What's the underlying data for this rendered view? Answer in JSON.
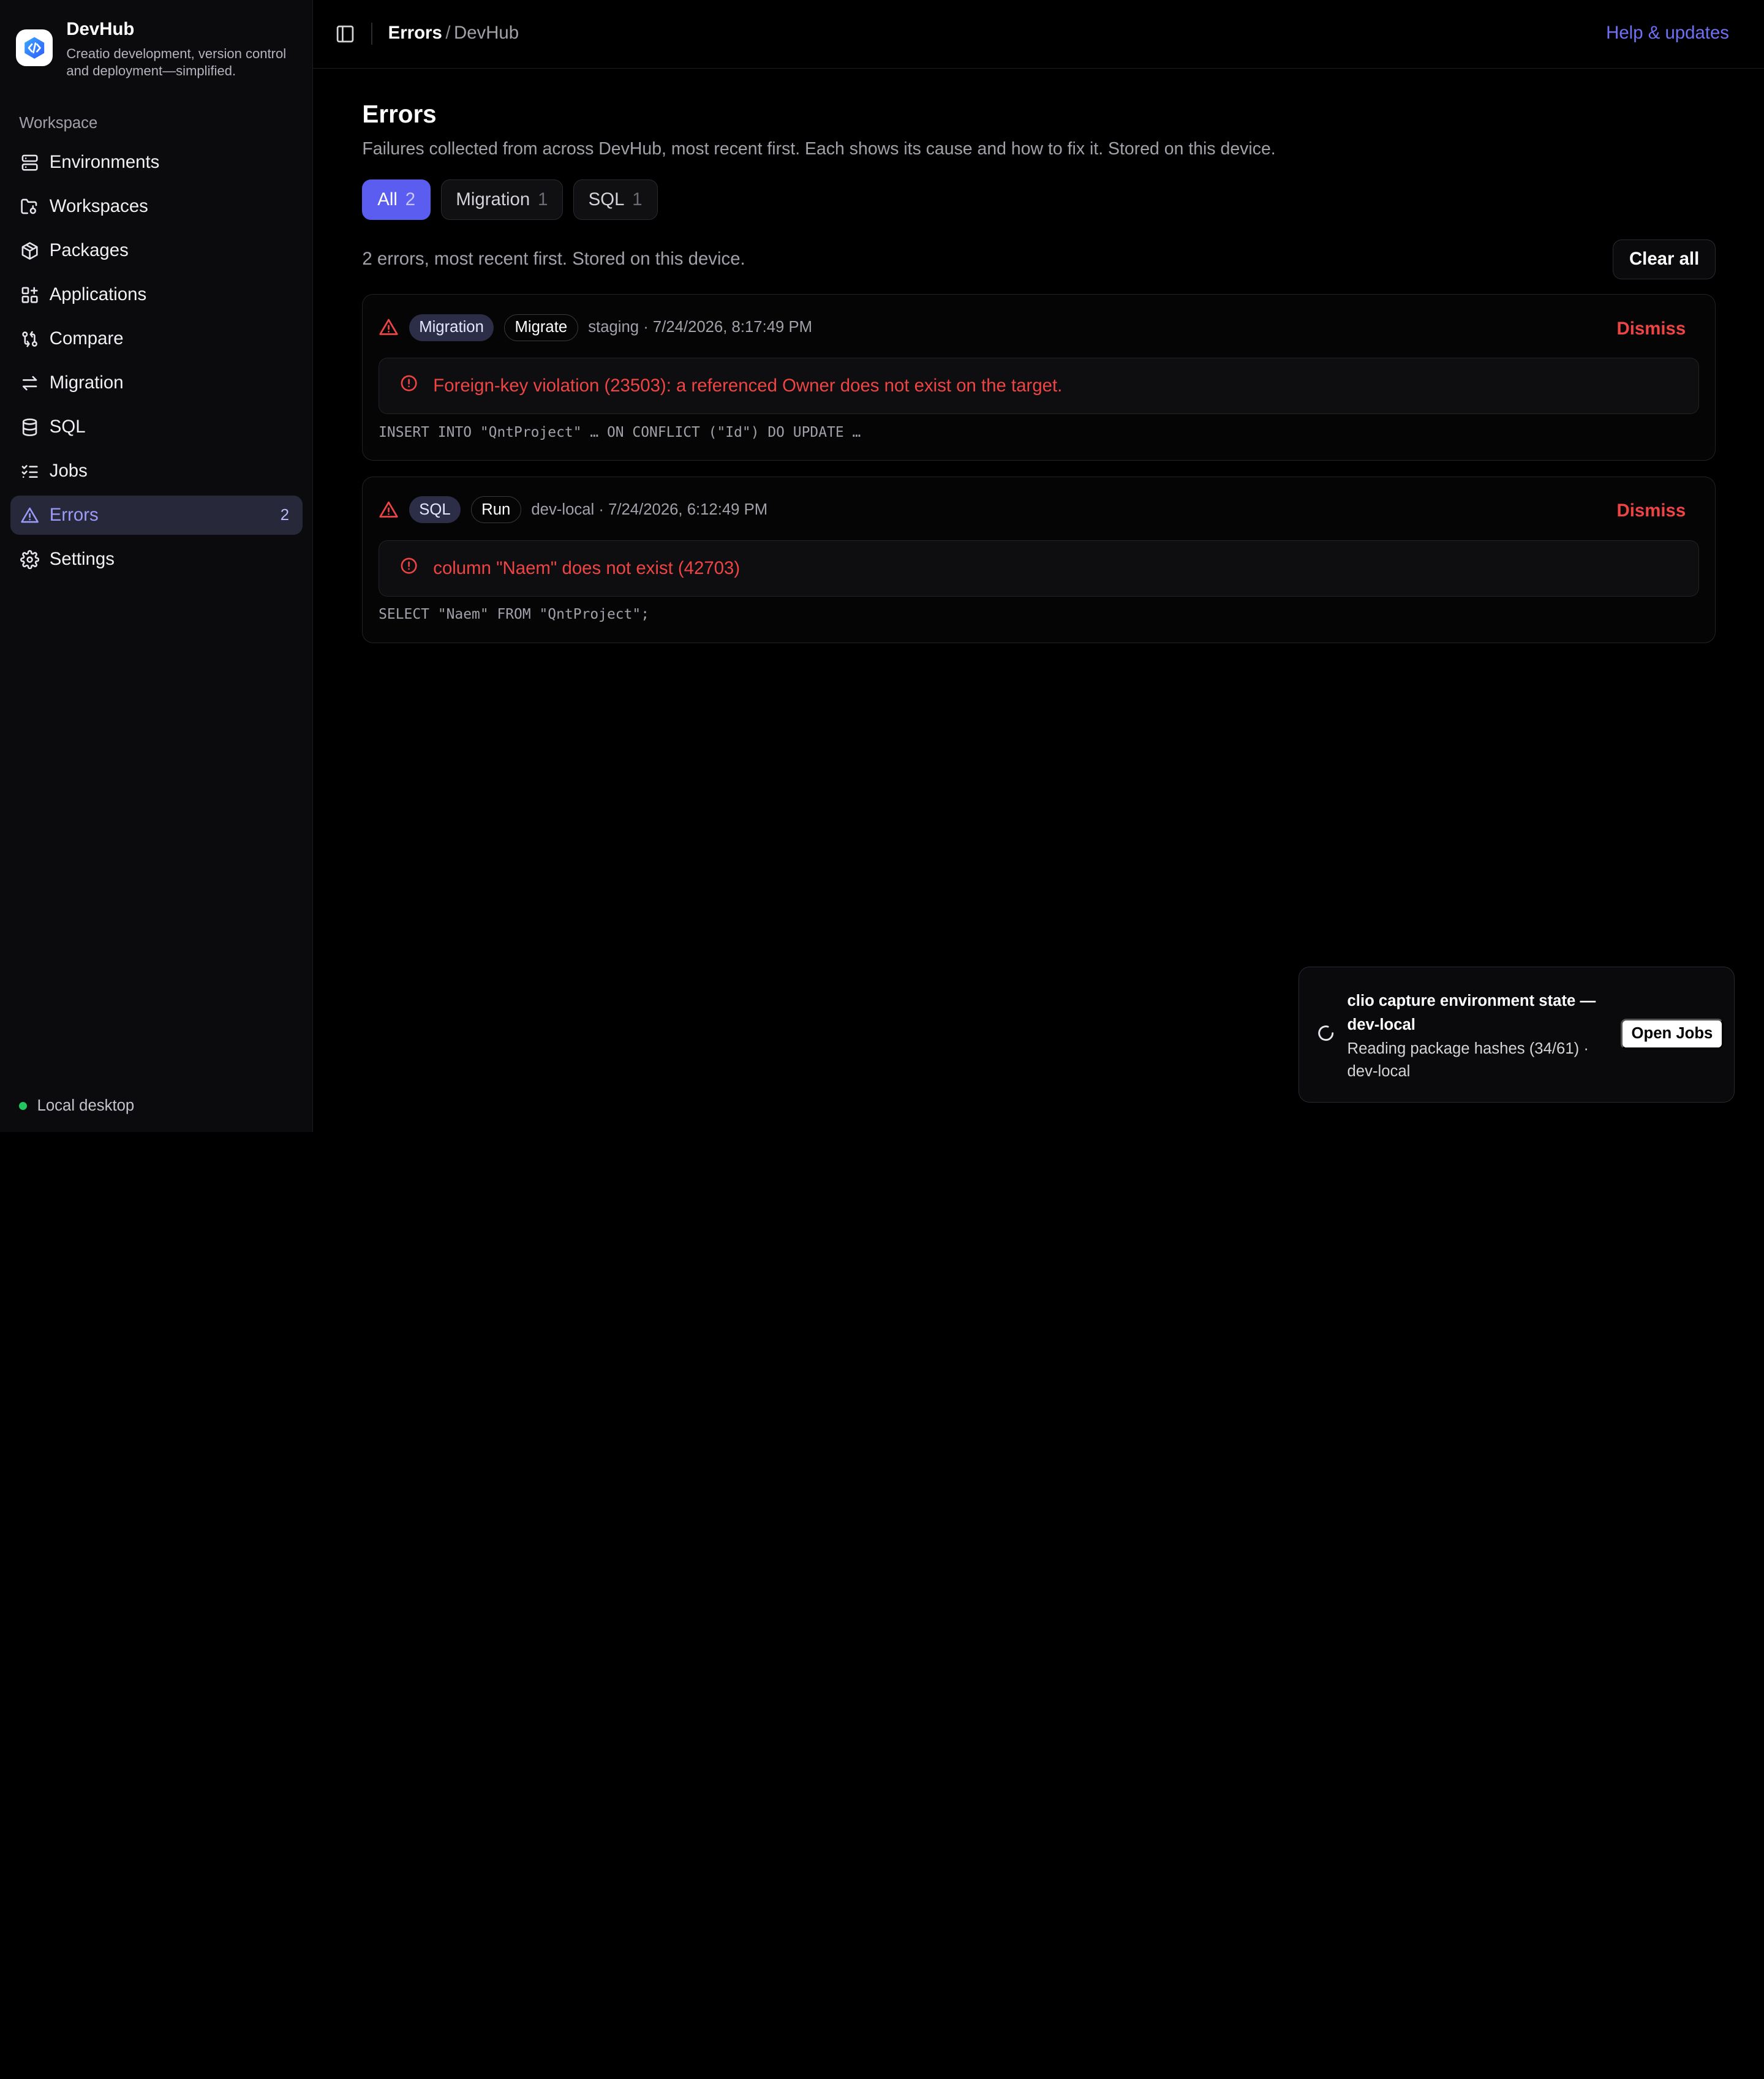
{
  "brand": {
    "name": "DevHub",
    "tagline": "Creatio development, version control and deployment—simplified."
  },
  "sidebar": {
    "section_label": "Workspace",
    "items": [
      {
        "label": "Environments",
        "icon": "server-icon"
      },
      {
        "label": "Workspaces",
        "icon": "folder-git-icon"
      },
      {
        "label": "Packages",
        "icon": "package-icon"
      },
      {
        "label": "Applications",
        "icon": "grid-plus-icon"
      },
      {
        "label": "Compare",
        "icon": "git-compare-icon"
      },
      {
        "label": "Migration",
        "icon": "arrows-swap-icon"
      },
      {
        "label": "SQL",
        "icon": "database-icon"
      },
      {
        "label": "Jobs",
        "icon": "list-checks-icon"
      },
      {
        "label": "Errors",
        "icon": "warning-icon",
        "count": "2",
        "active": true
      },
      {
        "label": "Settings",
        "icon": "gear-icon"
      }
    ],
    "footer_status": "Local desktop"
  },
  "header": {
    "breadcrumb_current": "Errors",
    "breadcrumb_separator": "/",
    "breadcrumb_parent": "DevHub",
    "help_link": "Help & updates"
  },
  "page": {
    "title": "Errors",
    "description": "Failures collected from across DevHub, most recent first. Each shows its cause and how to fix it. Stored on this device.",
    "filters": [
      {
        "label": "All",
        "count": "2",
        "active": true
      },
      {
        "label": "Migration",
        "count": "1"
      },
      {
        "label": "SQL",
        "count": "1"
      }
    ],
    "summary": "2 errors, most recent first. Stored on this device.",
    "clear_all_label": "Clear all"
  },
  "errors": [
    {
      "kind": "Migration",
      "operation": "Migrate",
      "meta": "staging · 7/24/2026, 8:17:49 PM",
      "dismiss_label": "Dismiss",
      "message": "Foreign-key violation (23503): a referenced Owner does not exist on the target.",
      "code": "INSERT INTO \"QntProject\" … ON CONFLICT (\"Id\") DO UPDATE …"
    },
    {
      "kind": "SQL",
      "operation": "Run",
      "meta": "dev-local · 7/24/2026, 6:12:49 PM",
      "dismiss_label": "Dismiss",
      "message": "column \"Naem\" does not exist (42703)",
      "code": "SELECT \"Naem\" FROM \"QntProject\";"
    }
  ],
  "toast": {
    "title": "clio capture environment state — dev-local",
    "body": "Reading package hashes (34/61) · dev-local",
    "action_label": "Open Jobs"
  },
  "colors": {
    "accent": "#5b5cf0",
    "error": "#ef4444",
    "status_online": "#22c55e"
  }
}
